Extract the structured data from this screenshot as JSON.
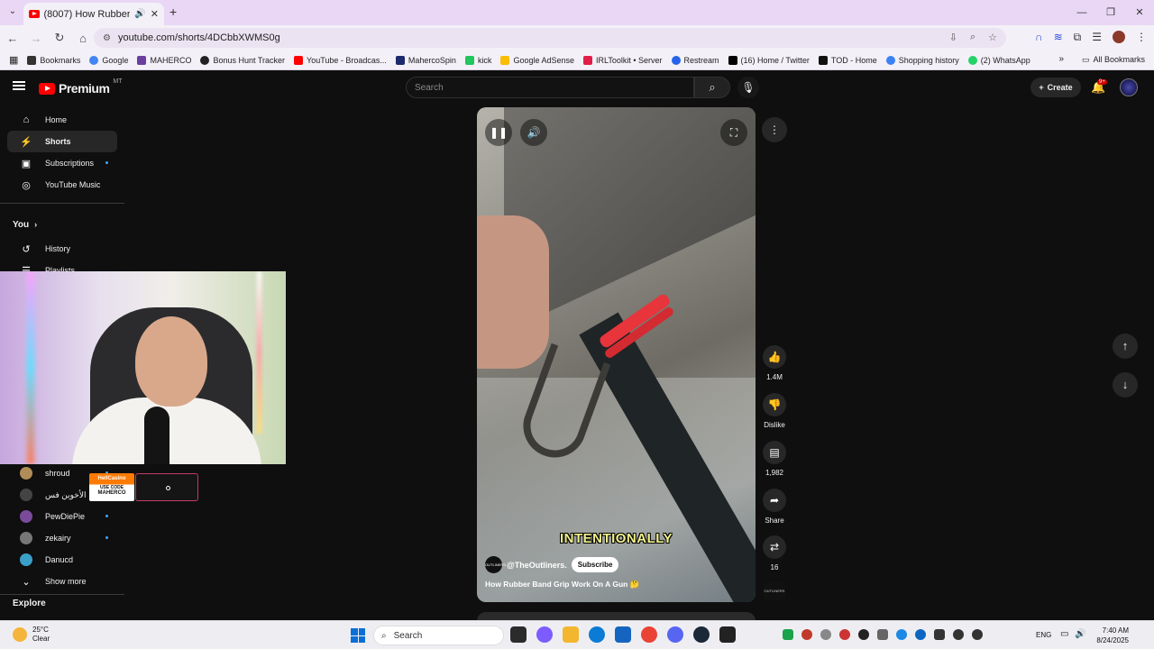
{
  "browser": {
    "tab_title": "(8007) How Rubber Band G",
    "new_tab": "+",
    "url": "youtube.com/shorts/4DCbbXWMS0g",
    "bookmarks": [
      {
        "label": "Bookmarks",
        "color": "#333333"
      },
      {
        "label": "Google",
        "color": "#4285f4"
      },
      {
        "label": "MAHERCO",
        "color": "#6b3fa0"
      },
      {
        "label": "Bonus Hunt Tracker",
        "color": "#222222"
      },
      {
        "label": "YouTube - Broadcas...",
        "color": "#ff0000"
      },
      {
        "label": "MahercoSpin",
        "color": "#1d2a6b"
      },
      {
        "label": "kick",
        "color": "#22c55e"
      },
      {
        "label": "Google AdSense",
        "color": "#fbbc05"
      },
      {
        "label": "IRLToolkit • Server",
        "color": "#e11d48"
      },
      {
        "label": "Restream",
        "color": "#2563eb"
      },
      {
        "label": "(16) Home / Twitter",
        "color": "#000000"
      },
      {
        "label": "TOD - Home",
        "color": "#111111"
      },
      {
        "label": "Shopping history",
        "color": "#3b82f6"
      },
      {
        "label": "(2) WhatsApp",
        "color": "#25d366"
      }
    ],
    "more_bookmarks": "»",
    "all_bookmarks": "All Bookmarks"
  },
  "youtube": {
    "logo_text": "Premium",
    "country_code": "MT",
    "search_placeholder": "Search",
    "create_label": "Create",
    "notif_badge": "9+",
    "sidebar": {
      "items": [
        {
          "label": "Home",
          "icon": "⌂"
        },
        {
          "label": "Shorts",
          "icon": "⚡"
        },
        {
          "label": "Subscriptions",
          "icon": "▣"
        },
        {
          "label": "YouTube Music",
          "icon": "◎"
        }
      ],
      "you_heading": "You",
      "you_items": [
        {
          "label": "History",
          "icon": "↺"
        },
        {
          "label": "Playlists",
          "icon": "☰"
        }
      ],
      "subscriptions": [
        {
          "label": "shroud",
          "color": "#b08d57"
        },
        {
          "label": "الأخوين فس",
          "color": "#444444"
        },
        {
          "label": "PewDiePie",
          "color": "#7a4b9a"
        },
        {
          "label": "zekairy",
          "color": "#777777"
        },
        {
          "label": "Danucd",
          "color": "#3aa0c8"
        }
      ],
      "show_more": "Show more",
      "explore": "Explore"
    },
    "overlay": {
      "casino_brand": "HellCasino",
      "casino_code_line1": "USE CODE",
      "casino_code_line2": "MAHERCO"
    },
    "short": {
      "caption": "INTENTIONALLY",
      "channel": "@TheOutliners.",
      "channel_logo": "OUTLINERS",
      "subscribe": "Subscribe",
      "title": "How Rubber Band Grip Work On A Gun 🤔"
    },
    "actions": {
      "likes": "1.4M",
      "dislike": "Dislike",
      "comments": "1,982",
      "share": "Share",
      "remix": "16"
    }
  },
  "taskbar": {
    "temperature": "25°C",
    "condition": "Clear",
    "search": "Search",
    "apps": [
      "#2b2b2b",
      "#7c5cff",
      "#f2b72f",
      "#0c7bd6",
      "#1565c0",
      "#ea4335",
      "#5865f2",
      "#1b2838",
      "#222222"
    ],
    "tray": [
      "#1aa34a",
      "#c0392b",
      "#888888",
      "#cc3333",
      "#222222",
      "#666666",
      "#1e88e5",
      "#0a66c2",
      "#333333",
      "#333333",
      "#333333"
    ],
    "language": "ENG",
    "time": "7:40 AM",
    "date": "8/24/2025"
  }
}
